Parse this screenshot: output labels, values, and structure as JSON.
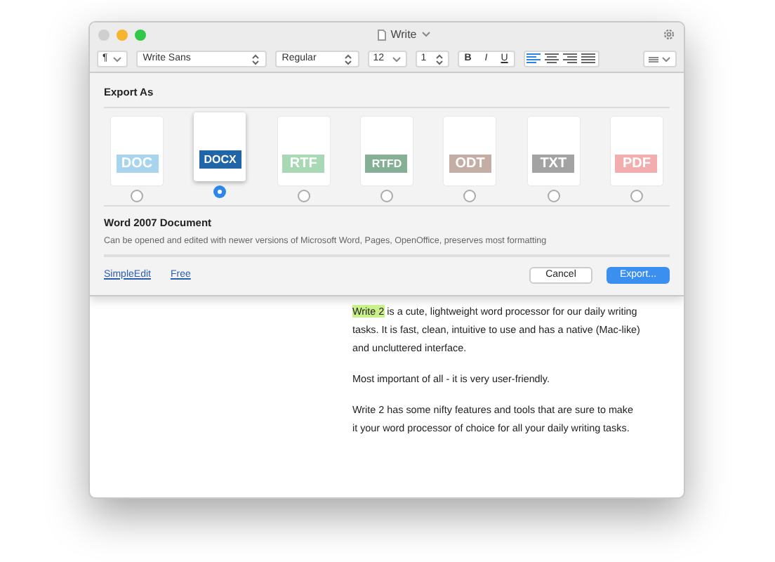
{
  "window": {
    "title": "Write"
  },
  "toolbar": {
    "paragraph_menu": "¶",
    "font": "Write Sans",
    "style": "Regular",
    "size": "12",
    "spacing": "1",
    "format_buttons": [
      "B",
      "I",
      "U"
    ],
    "alignments": [
      {
        "kind": "left",
        "selected": true
      },
      {
        "kind": "center",
        "selected": false
      },
      {
        "kind": "right",
        "selected": false
      },
      {
        "kind": "justify",
        "selected": false
      }
    ]
  },
  "export_sheet": {
    "title": "Export As",
    "formats": [
      {
        "label": "DOC",
        "color": "#a9d4ee",
        "selected": false
      },
      {
        "label": "DOCX",
        "color": "#1f65a8",
        "selected": true
      },
      {
        "label": "RTF",
        "color": "#a8d8b4",
        "selected": false
      },
      {
        "label": "RTFD",
        "color": "#86b096",
        "selected": false
      },
      {
        "label": "ODT",
        "color": "#c4ada4",
        "selected": false
      },
      {
        "label": "TXT",
        "color": "#a3a3a3",
        "selected": false
      },
      {
        "label": "PDF",
        "color": "#f2aeae",
        "selected": false
      }
    ],
    "description_title": "Word 2007 Document",
    "description": "Can be opened and edited with newer versions of Microsoft Word, Pages, OpenOffice, preserves most formatting",
    "links": [
      "SimpleEdit",
      "Free"
    ],
    "buttons": [
      {
        "label": "Cancel",
        "kind": "secondary"
      },
      {
        "label": "Export...",
        "kind": "primary"
      }
    ]
  },
  "document": {
    "paragraphs": [
      {
        "highlighted": "Write 2",
        "text": " is a cute, lightweight word processor for our daily writing tasks. It is fast, clean, intuitive to use and has a native (Mac-like) and uncluttered interface."
      },
      {
        "text": "Most important of all - it is very user-friendly."
      },
      {
        "text": "Write 2 has some nifty features and tools that are sure to make it your word processor of choice for all your daily writing tasks."
      }
    ]
  }
}
